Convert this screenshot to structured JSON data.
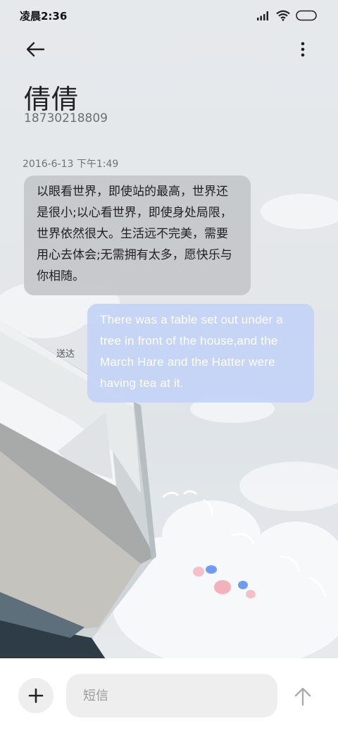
{
  "status_bar": {
    "time": "凌晨2:36",
    "icons": [
      "signal-icon",
      "wifi-icon",
      "battery-icon"
    ]
  },
  "header": {
    "back_icon": "arrow-left-icon",
    "more_icon": "more-vertical-icon"
  },
  "contact": {
    "name": "倩倩",
    "number": "18730218809"
  },
  "conversation": {
    "timestamp": "2016-6-13 下午1:49",
    "incoming_message": "以眼看世界，即使站的最高，世界还是很小;以心看世界，即使身处局限，世界依然很大。生活远不完美，需要用心去体会;无需拥有太多，愿快乐与你相随。",
    "outgoing_message": "There was a table set out under a tree in front of the house,and the March Hare and the Hatter were having tea at it.",
    "delivery_status": "送达"
  },
  "composer": {
    "add_icon": "plus-icon",
    "placeholder": "短信",
    "value": "",
    "send_icon": "arrow-up-icon"
  },
  "colors": {
    "incoming_bubble": "#c4c7ca",
    "outgoing_bubble": "#c4d3f5",
    "background": "#e4e8eb"
  }
}
